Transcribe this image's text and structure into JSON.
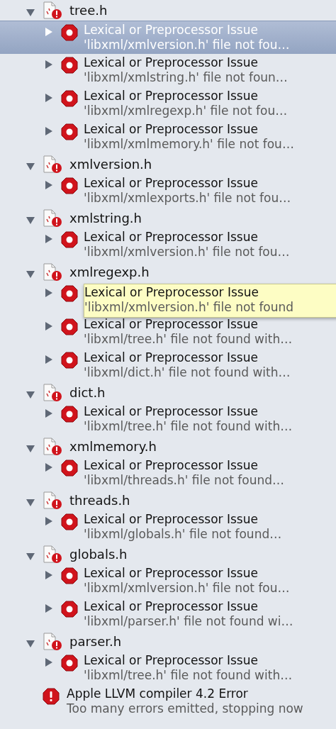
{
  "groups": [
    {
      "file": "tree.h",
      "expanded": true,
      "issues": [
        {
          "title": "Lexical or Preprocessor Issue",
          "message": "'libxml/xmlversion.h' file not fou…",
          "expanded": false,
          "selected": true
        },
        {
          "title": "Lexical or Preprocessor Issue",
          "message": "'libxml/xmlstring.h' file not foun…",
          "expanded": false,
          "selected": false
        },
        {
          "title": "Lexical or Preprocessor Issue",
          "message": "'libxml/xmlregexp.h' file not fou…",
          "expanded": false,
          "selected": false
        },
        {
          "title": "Lexical or Preprocessor Issue",
          "message": "'libxml/xmlmemory.h' file not fou…",
          "expanded": false,
          "selected": false
        }
      ]
    },
    {
      "file": "xmlversion.h",
      "expanded": true,
      "issues": [
        {
          "title": "Lexical or Preprocessor Issue",
          "message": "'libxml/xmlexports.h' file not fou…",
          "expanded": false,
          "selected": false
        }
      ]
    },
    {
      "file": "xmlstring.h",
      "expanded": true,
      "issues": [
        {
          "title": "Lexical or Preprocessor Issue",
          "message": "'libxml/xmlversion.h' file not fou…",
          "expanded": false,
          "selected": false
        }
      ]
    },
    {
      "file": "xmlregexp.h",
      "expanded": true,
      "issues": [
        {
          "expanded": false,
          "selected": false,
          "tooltip": {
            "title": "Lexical or Preprocessor Issue",
            "message": "'libxml/xmlversion.h' file not found"
          }
        },
        {
          "title": "Lexical or Preprocessor Issue",
          "message": "'libxml/tree.h' file not found with…",
          "expanded": false,
          "selected": false
        },
        {
          "title": "Lexical or Preprocessor Issue",
          "message": "'libxml/dict.h' file not found with…",
          "expanded": false,
          "selected": false
        }
      ]
    },
    {
      "file": "dict.h",
      "expanded": true,
      "issues": [
        {
          "title": "Lexical or Preprocessor Issue",
          "message": "'libxml/tree.h' file not found with…",
          "expanded": false,
          "selected": false
        }
      ]
    },
    {
      "file": "xmlmemory.h",
      "expanded": true,
      "issues": [
        {
          "title": "Lexical or Preprocessor Issue",
          "message": "'libxml/threads.h' file not found…",
          "expanded": false,
          "selected": false
        }
      ]
    },
    {
      "file": "threads.h",
      "expanded": true,
      "issues": [
        {
          "title": "Lexical or Preprocessor Issue",
          "message": "'libxml/globals.h' file not found…",
          "expanded": false,
          "selected": false
        }
      ]
    },
    {
      "file": "globals.h",
      "expanded": true,
      "issues": [
        {
          "title": "Lexical or Preprocessor Issue",
          "message": "'libxml/xmlversion.h' file not fou…",
          "expanded": false,
          "selected": false
        },
        {
          "title": "Lexical or Preprocessor Issue",
          "message": "'libxml/parser.h' file not found wi…",
          "expanded": false,
          "selected": false
        }
      ]
    },
    {
      "file": "parser.h",
      "expanded": true,
      "issues": [
        {
          "title": "Lexical or Preprocessor Issue",
          "message": "'libxml/tree.h' file not found with…",
          "expanded": false,
          "selected": false
        }
      ]
    }
  ],
  "final_error": {
    "title": "Apple LLVM compiler 4.2 Error",
    "message": "Too many errors emitted, stopping now"
  }
}
